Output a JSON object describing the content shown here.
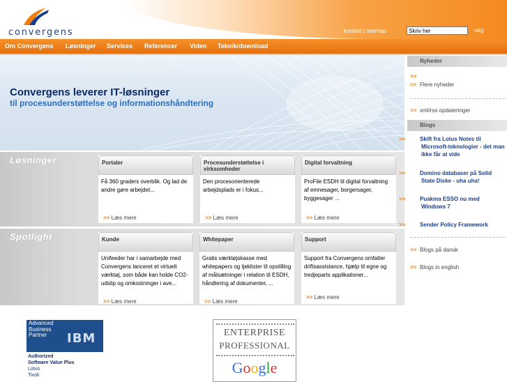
{
  "header": {
    "logo_text": "convergens",
    "top_links": "kontakt | sitemap",
    "search": {
      "value": "Skriv her",
      "button": "søg"
    }
  },
  "nav": {
    "items": [
      "Om Convergens",
      "Løsninger",
      "Services",
      "Referencer",
      "Viden",
      "Teknik/download"
    ]
  },
  "hero": {
    "title": "Convergens leverer IT-løsninger",
    "subtitle": "til procesunderstøttelse og informationshåndtering"
  },
  "losninger": {
    "label": "Løsninger",
    "cards": [
      {
        "title": "Portaler",
        "body": "Få 360 graders overblik. Og lad de andre gøre arbejdet...",
        "more": "Læs mere"
      },
      {
        "title": "Procesunderstøttelse i virksomheder",
        "body": "Den procesorienterede arbejdsplads er i fokus...",
        "more": "Læs mere"
      },
      {
        "title": "Digital forvaltning",
        "body": "ProFile ESDH til digital forvaltning af emnesager, borgersager, byggesager ...",
        "more": "Læs mere"
      }
    ]
  },
  "spotlight": {
    "label": "Spotlight",
    "cards": [
      {
        "title": "Kunde",
        "body": "Unifeeder har i samarbejde med Convergens lanceret et virtuelt værktøj, som både kan holde CO2-udslip og omkostninger i ave...",
        "more": "Læs mere"
      },
      {
        "title": "Whitepaper",
        "body": "Gratis værktøjskasse med whitepapers og tjeklister til opstilling af målsætninger i relation til ESDH, håndtering af dokumenter, ...",
        "more": "Læs mere"
      },
      {
        "title": "Support",
        "body": "Support fra Convergens omfatter driftsassistance, hjælp til egne og tredjeparts applikationer...",
        "more": "Læs mere"
      }
    ]
  },
  "sidebar": {
    "arrows": ">>",
    "nyheder_head": "Nyheder",
    "more_news": "Flere nyheder",
    "xml_rss": "xml/rss opdateringer",
    "blogs_head": "Blogs",
    "blogs": [
      "Skift fra Lotus Notes til Microsoft-teknologier - det man ikke får at vide",
      "Domino databaser på Solid State Diske - uha uha!",
      "Puakma ESSO nu med Windows 7",
      "Sender Policy Framework"
    ],
    "blogs_danish": "Blogs på dansk",
    "blogs_english": "Blogs in english"
  },
  "partners": {
    "ibm_lines": [
      "Advanced",
      "Business",
      "Partner"
    ],
    "ibm_logo_text": "IBM",
    "ibm_caption": [
      "Authorized",
      "Software Value Plus",
      "Lotus",
      "Tivoli"
    ],
    "google_line1": "ENTERPRISE",
    "google_line2": "PROFESSIONAL",
    "google_logo_text": "Google"
  },
  "colors": {
    "orange": "#f07d10",
    "navy": "#0b2a66",
    "blue": "#2a6ec0"
  }
}
